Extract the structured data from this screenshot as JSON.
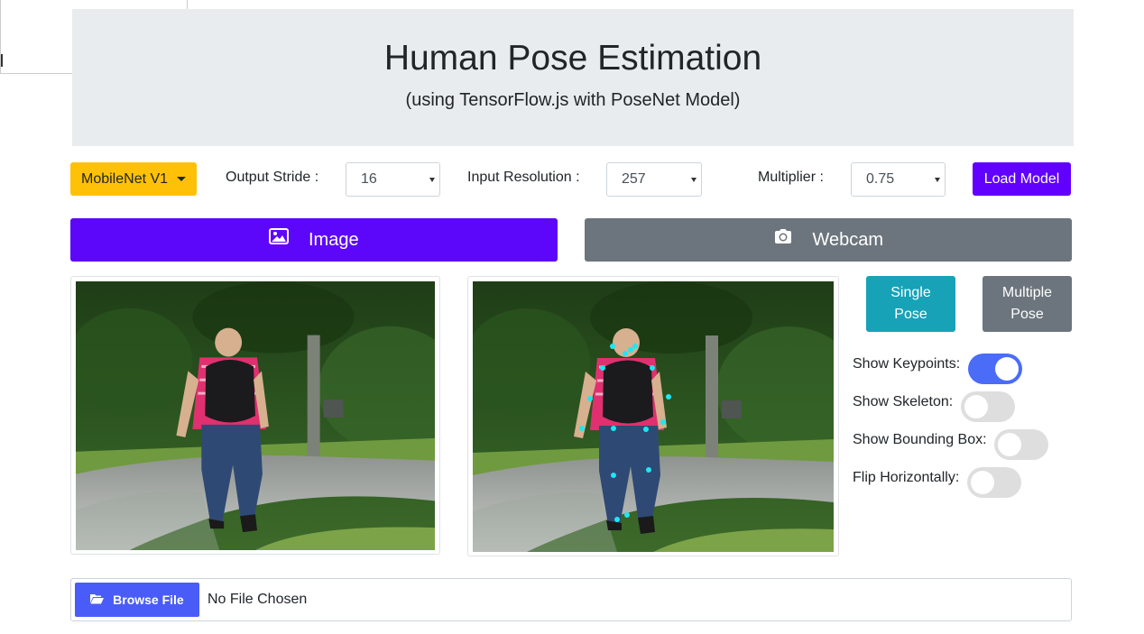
{
  "header": {
    "title": "Human Pose Estimation",
    "subtitle": "(using TensorFlow.js with PoseNet Model)"
  },
  "toolbar": {
    "model_dropdown": "MobileNet V1",
    "output_stride_label": "Output Stride :",
    "output_stride_value": "16",
    "input_resolution_label": "Input Resolution :",
    "input_resolution_value": "257",
    "multiplier_label": "Multiplier :",
    "multiplier_value": "0.75",
    "load_model_label": "Load Model"
  },
  "source_tabs": {
    "image_label": "Image",
    "image_icon": "image-icon",
    "webcam_label": "Webcam",
    "webcam_icon": "camera-icon"
  },
  "pose_mode": {
    "single_line1": "Single",
    "single_line2": "Pose",
    "multiple_line1": "Multiple",
    "multiple_line2": "Pose"
  },
  "options": [
    {
      "label": "Show Keypoints:",
      "enabled": true
    },
    {
      "label": "Show Skeleton:",
      "enabled": false
    },
    {
      "label": "Show Bounding Box:",
      "enabled": false
    },
    {
      "label": "Flip Horizontally:",
      "enabled": false
    }
  ],
  "file_input": {
    "browse_label": "Browse File",
    "browse_icon": "folder-open-icon",
    "status": "No File Chosen"
  },
  "colors": {
    "accent_purple": "#5d07fa",
    "warning_yellow": "#ffc107",
    "info_teal": "#17a2b8",
    "secondary_gray": "#6c757d",
    "toggle_on": "#4a6cf7",
    "keypoint": "#00e5ff"
  }
}
